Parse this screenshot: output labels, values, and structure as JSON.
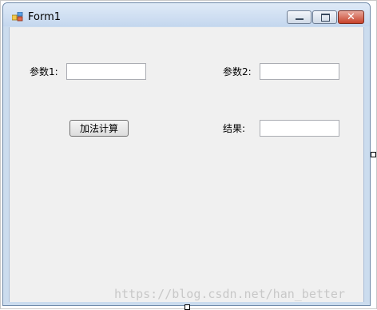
{
  "window": {
    "title": "Form1",
    "minimize_icon": "minimize-icon",
    "maximize_icon": "maximize-icon",
    "close_glyph": "✕"
  },
  "form": {
    "param1_label": "参数1:",
    "param2_label": "参数2:",
    "result_label": "结果:",
    "param1_value": "",
    "param2_value": "",
    "result_value": "",
    "add_button_label": "加法计算"
  },
  "watermark": "https://blog.csdn.net/han_better",
  "colors": {
    "titlebar": "#c4d7ee",
    "client_bg": "#f0f0f0",
    "close_button": "#c8422b"
  }
}
